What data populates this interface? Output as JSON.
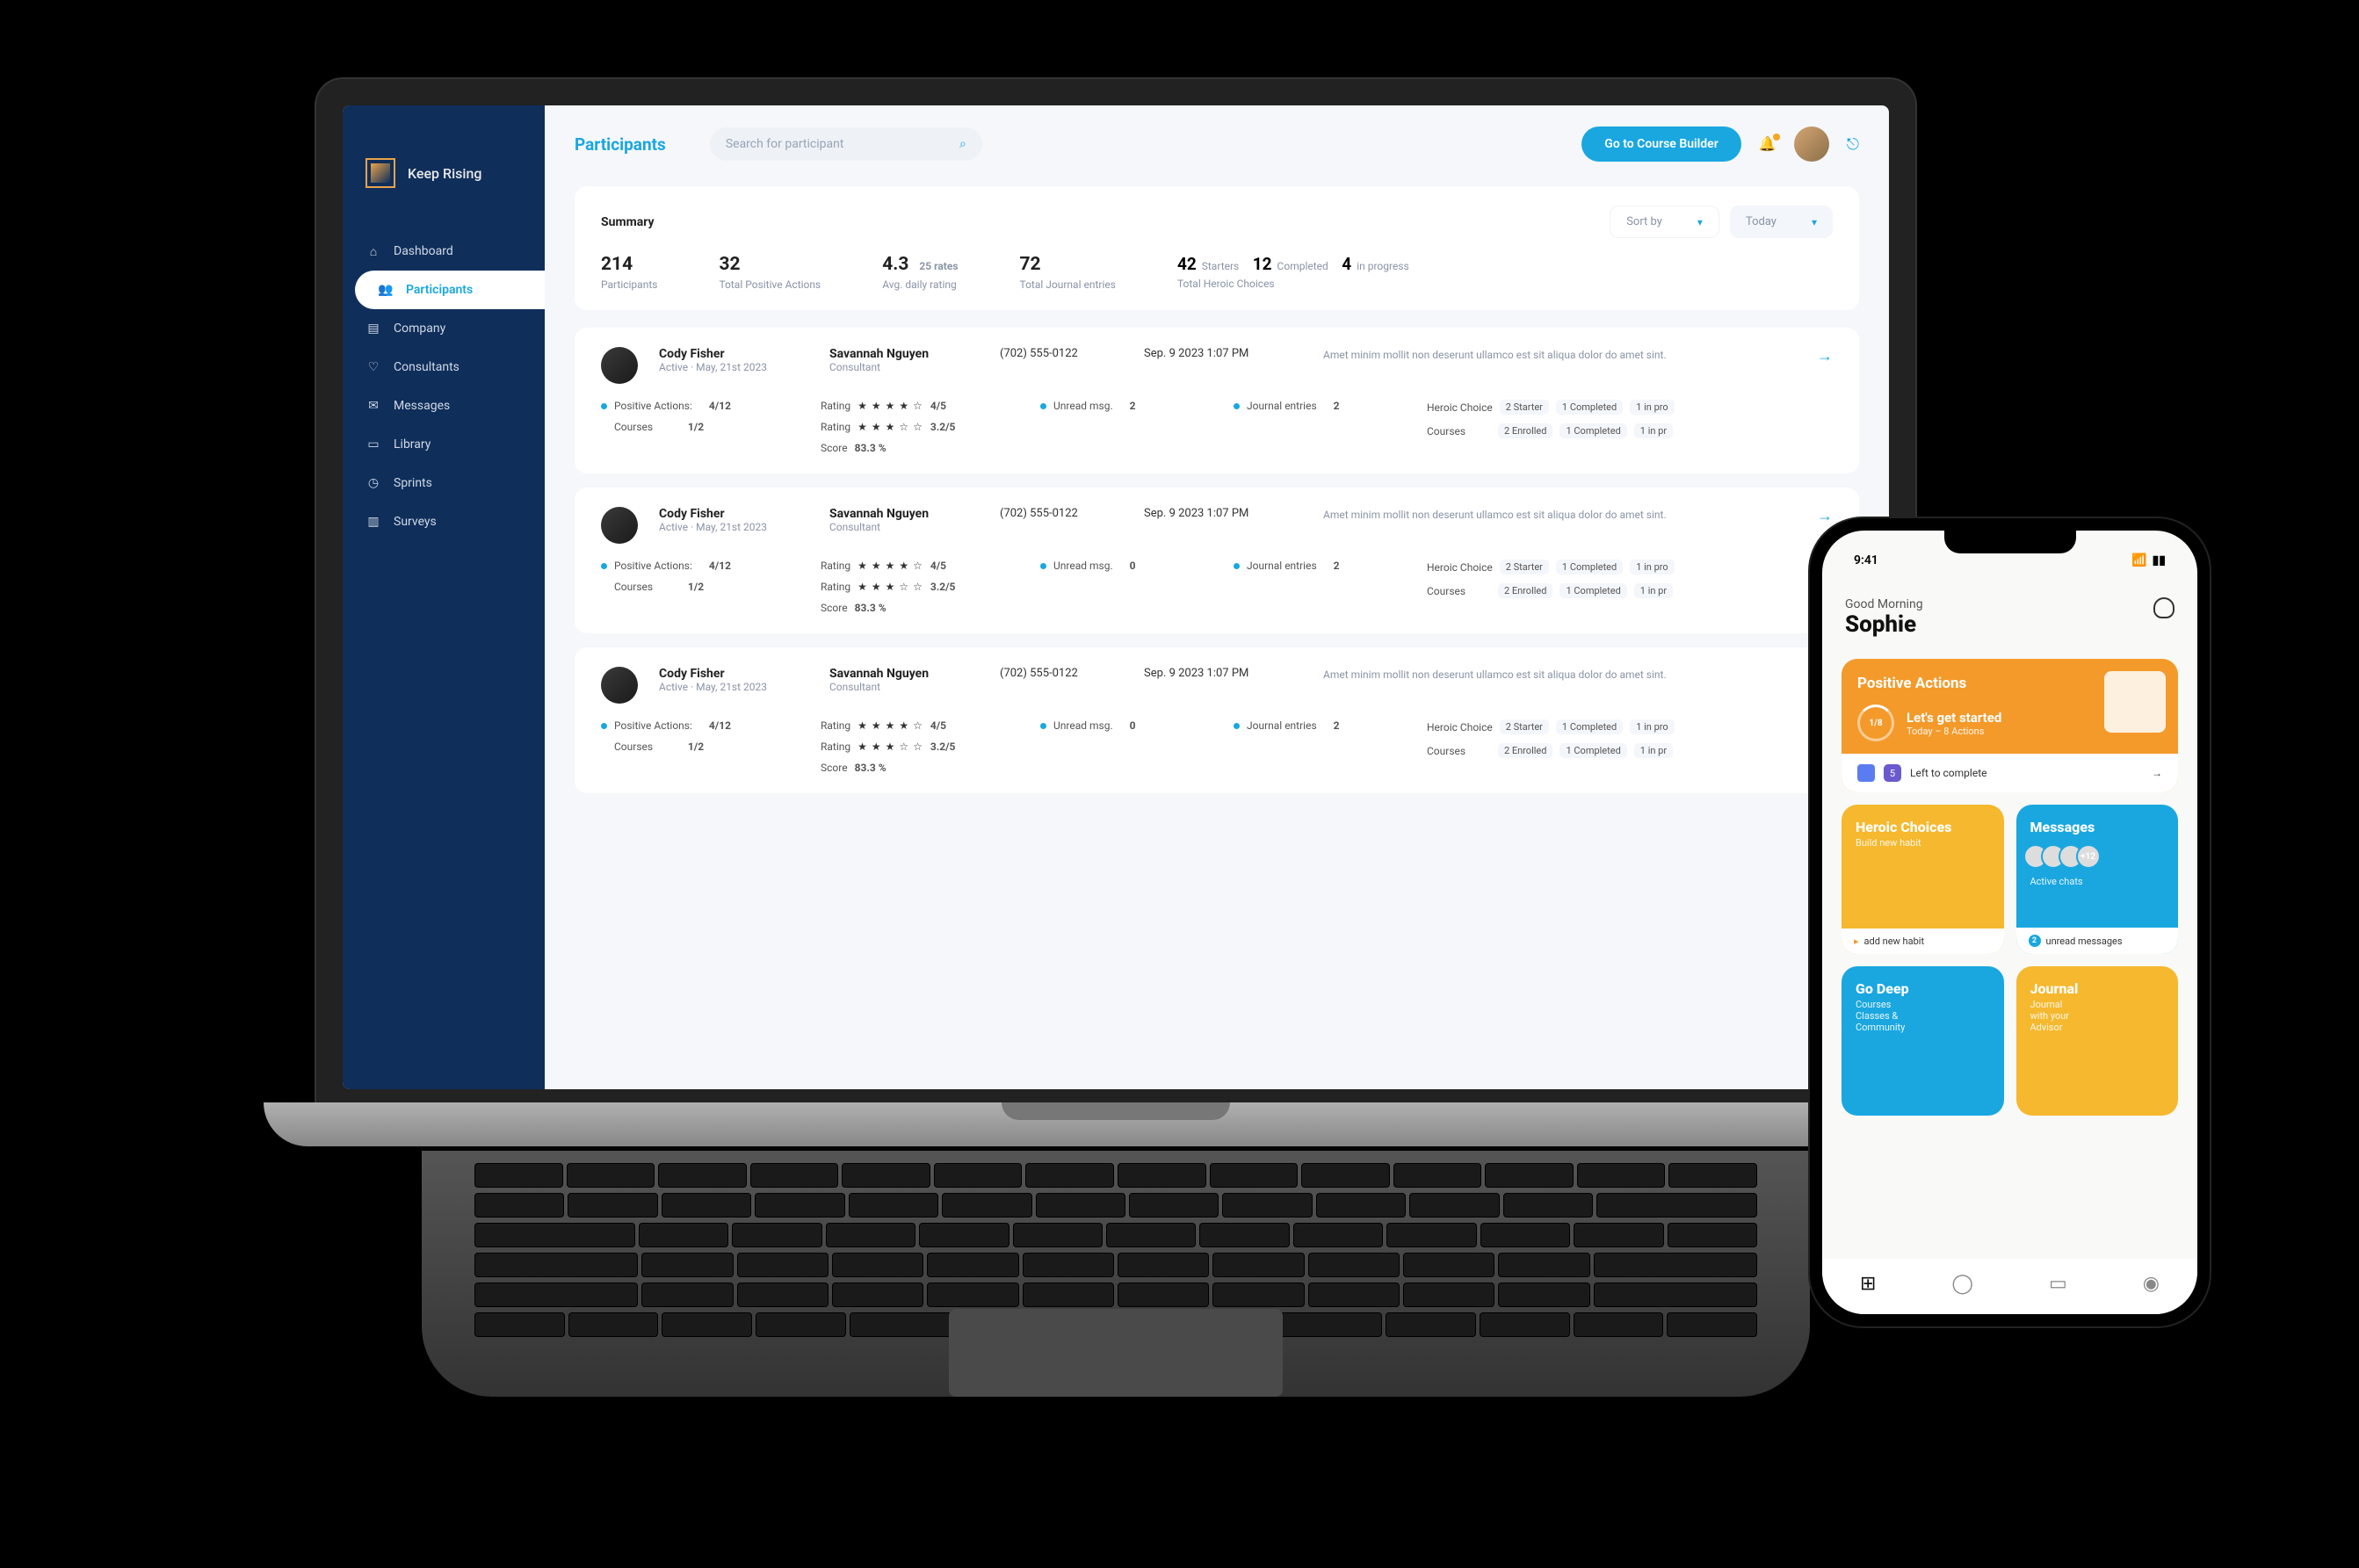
{
  "brand": "Keep Rising",
  "nav": [
    "Dashboard",
    "Participants",
    "Company",
    "Consultants",
    "Messages",
    "Library",
    "Sprints",
    "Surveys"
  ],
  "pageTitle": "Participants",
  "searchPlaceholder": "Search for participant",
  "cta": "Go to Course Builder",
  "summary": {
    "title": "Summary",
    "sortBy": "Sort by",
    "period": "Today",
    "metrics": {
      "participants": {
        "v": "214",
        "l": "Participants"
      },
      "tpa": {
        "v": "32",
        "l": "Total Positive Actions"
      },
      "avg": {
        "v": "4.3",
        "sub": "25 rates",
        "l": "Avg. daily rating"
      },
      "journal": {
        "v": "72",
        "l": "Total Journal entries"
      },
      "heroic": {
        "starters": "42",
        "sl": "Starters",
        "completed": "12",
        "cl": "Completed",
        "progress": "4",
        "pl": "in progress",
        "l": "Total Heroic Choices"
      }
    }
  },
  "rows": [
    {
      "name": "Cody Fisher",
      "status": "Active",
      "date": "May, 21st 2023",
      "consultant": "Savannah Nguyen",
      "role": "Consultant",
      "phone": "(702) 555-0122",
      "when": "Sep. 9 2023   1:07 PM",
      "note": "Amet minim mollit non deserunt ullamco est sit aliqua dolor do amet sint.",
      "pa": "4/12",
      "courses": "1/2",
      "r1": "4/5",
      "r2": "3.2/5",
      "score": "83.3 %",
      "unread": "2",
      "je": "2",
      "hc1": "2 Starter",
      "hc2": "1 Completed",
      "hc3": "1 in pro",
      "c1": "2 Enrolled",
      "c2": "1 Completed",
      "c3": "1 in pr"
    },
    {
      "name": "Cody Fisher",
      "status": "Active",
      "date": "May, 21st 2023",
      "consultant": "Savannah Nguyen",
      "role": "Consultant",
      "phone": "(702) 555-0122",
      "when": "Sep. 9 2023   1:07 PM",
      "note": "Amet minim mollit non deserunt ullamco est sit aliqua dolor do amet sint.",
      "pa": "4/12",
      "courses": "1/2",
      "r1": "4/5",
      "r2": "3.2/5",
      "score": "83.3 %",
      "unread": "0",
      "je": "2",
      "hc1": "2 Starter",
      "hc2": "1 Completed",
      "hc3": "1 in pro",
      "c1": "2 Enrolled",
      "c2": "1 Completed",
      "c3": "1 in pr"
    },
    {
      "name": "Cody Fisher",
      "status": "Active",
      "date": "May, 21st 2023",
      "consultant": "Savannah Nguyen",
      "role": "Consultant",
      "phone": "(702) 555-0122",
      "when": "Sep. 9 2023   1:07 PM",
      "note": "Amet minim mollit non deserunt ullamco est sit aliqua dolor do amet sint.",
      "pa": "4/12",
      "courses": "1/2",
      "r1": "4/5",
      "r2": "3.2/5",
      "score": "83.3 %",
      "unread": "0",
      "je": "2",
      "hc1": "2 Starter",
      "hc2": "1 Completed",
      "hc3": "1 in pro",
      "c1": "2 Enrolled",
      "c2": "1 Completed",
      "c3": "1 in pr"
    }
  ],
  "labels": {
    "pa": "Positive Actions:",
    "courses": "Courses",
    "rating": "Rating",
    "score": "Score",
    "unread": "Unread msg.",
    "je": "Journal entries",
    "hc": "Heroic Choice"
  },
  "phone": {
    "time": "9:41",
    "greeting": "Good Morning",
    "user": "Sophie",
    "pa": {
      "title": "Positive Actions",
      "ring": "1/8",
      "lead": "Let's get started",
      "sub": "Today – 8 Actions",
      "footCount": "5",
      "foot": "Left to complete"
    },
    "tiles": {
      "hc": {
        "title": "Heroic Choices",
        "sub": "Build new habit",
        "foot": "add new habit"
      },
      "msg": {
        "title": "Messages",
        "plus": "+12",
        "sub": "Active chats",
        "footN": "2",
        "foot": "unread messages"
      },
      "gd": {
        "title": "Go Deep",
        "sub": "Courses\nClasses &\nCommunity"
      },
      "jr": {
        "title": "Journal",
        "sub": "Journal\nwith your\nAdvisor"
      }
    }
  }
}
